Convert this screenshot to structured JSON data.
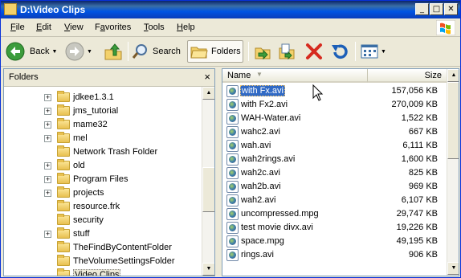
{
  "window": {
    "title": "D:\\Video Clips"
  },
  "title_buttons": {
    "minimize": "_",
    "maximize": "□",
    "close": "✕"
  },
  "menu": [
    "File",
    "Edit",
    "View",
    "Favorites",
    "Tools",
    "Help"
  ],
  "menu_underline": [
    "F",
    "E",
    "V",
    "a",
    "T",
    "H"
  ],
  "toolbar": {
    "back": "Back",
    "search": "Search",
    "folders": "Folders"
  },
  "folders_pane": {
    "title": "Folders",
    "close": "×"
  },
  "tree": [
    {
      "label": "jdkee1.3.1",
      "expander": true
    },
    {
      "label": "jms_tutorial",
      "expander": true
    },
    {
      "label": "mame32",
      "expander": true
    },
    {
      "label": "mel",
      "expander": true
    },
    {
      "label": "Network Trash Folder",
      "expander": false
    },
    {
      "label": "old",
      "expander": true
    },
    {
      "label": "Program Files",
      "expander": true
    },
    {
      "label": "projects",
      "expander": true
    },
    {
      "label": "resource.frk",
      "expander": false
    },
    {
      "label": "security",
      "expander": false
    },
    {
      "label": "stuff",
      "expander": true
    },
    {
      "label": "TheFindByContentFolder",
      "expander": false
    },
    {
      "label": "TheVolumeSettingsFolder",
      "expander": false
    },
    {
      "label": "Video Clips",
      "expander": false,
      "selected": true
    }
  ],
  "columns": {
    "name": "Name",
    "size": "Size"
  },
  "files": [
    {
      "name": "with Fx.avi",
      "size": "157,056 KB",
      "selected": true
    },
    {
      "name": "with Fx2.avi",
      "size": "270,009 KB"
    },
    {
      "name": "WAH-Water.avi",
      "size": "1,522 KB"
    },
    {
      "name": "wahc2.avi",
      "size": "667 KB"
    },
    {
      "name": "wah.avi",
      "size": "6,111 KB"
    },
    {
      "name": "wah2rings.avi",
      "size": "1,600 KB"
    },
    {
      "name": "wah2c.avi",
      "size": "825 KB"
    },
    {
      "name": "wah2b.avi",
      "size": "969 KB"
    },
    {
      "name": "wah2.avi",
      "size": "6,107 KB"
    },
    {
      "name": "uncompressed.mpg",
      "size": "29,747 KB"
    },
    {
      "name": "test movie divx.avi",
      "size": "19,226 KB"
    },
    {
      "name": "space.mpg",
      "size": "49,195 KB"
    },
    {
      "name": "rings.avi",
      "size": "906 KB"
    }
  ]
}
